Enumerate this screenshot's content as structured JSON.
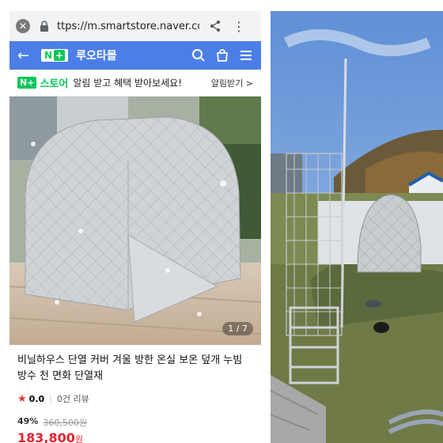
{
  "browser": {
    "url": "ttps://m.smartstore.naver.com/r",
    "close_icon": "close-circle-icon",
    "more_icon": "⋮"
  },
  "nav": {
    "back_icon": "←",
    "logo_n": "N",
    "logo_plus": "+",
    "store_name": "루오타몰"
  },
  "banner": {
    "nplus": "N+",
    "store_label": "스토어",
    "message": "알림 받고 혜택 받아보세요!",
    "alarm_label": "알림받기 >"
  },
  "gallery": {
    "counter": "1 / 7"
  },
  "product": {
    "title": "비닐하우스 단열 커버 겨울 방한 온실 보온 덮개 누빔 방수 천 면화 단열재",
    "star": "★",
    "rating": "0.0",
    "reviews": "0건 리뷰",
    "discount": "49%",
    "original_price": "360,500원",
    "price": "183,800",
    "price_unit": "원"
  },
  "colors": {
    "nav_bg": "#4d7ee8",
    "naver_green": "#03c75a",
    "price_red": "#e8212e"
  }
}
